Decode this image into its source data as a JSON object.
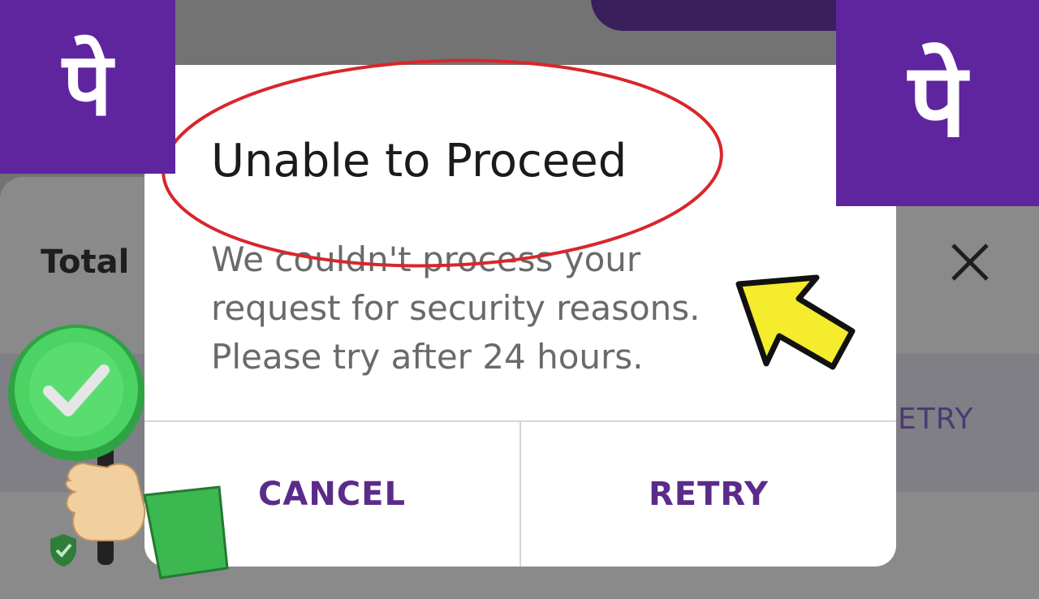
{
  "background": {
    "total_label": "Total",
    "retry_label": "ETRY"
  },
  "dialog": {
    "title": "Unable to Proceed",
    "message": "We couldn't process your request for security reasons. Please try after 24 hours.",
    "cancel_label": "CANCEL",
    "retry_label": "RETRY"
  },
  "logos": {
    "left": "पे",
    "right": "पे"
  },
  "colors": {
    "brand_purple": "#5f259f",
    "button_text": "#5b2b8a",
    "annotation_red": "#d8262b",
    "arrow_yellow": "#f4ec2c",
    "check_green": "#3fd35a"
  }
}
